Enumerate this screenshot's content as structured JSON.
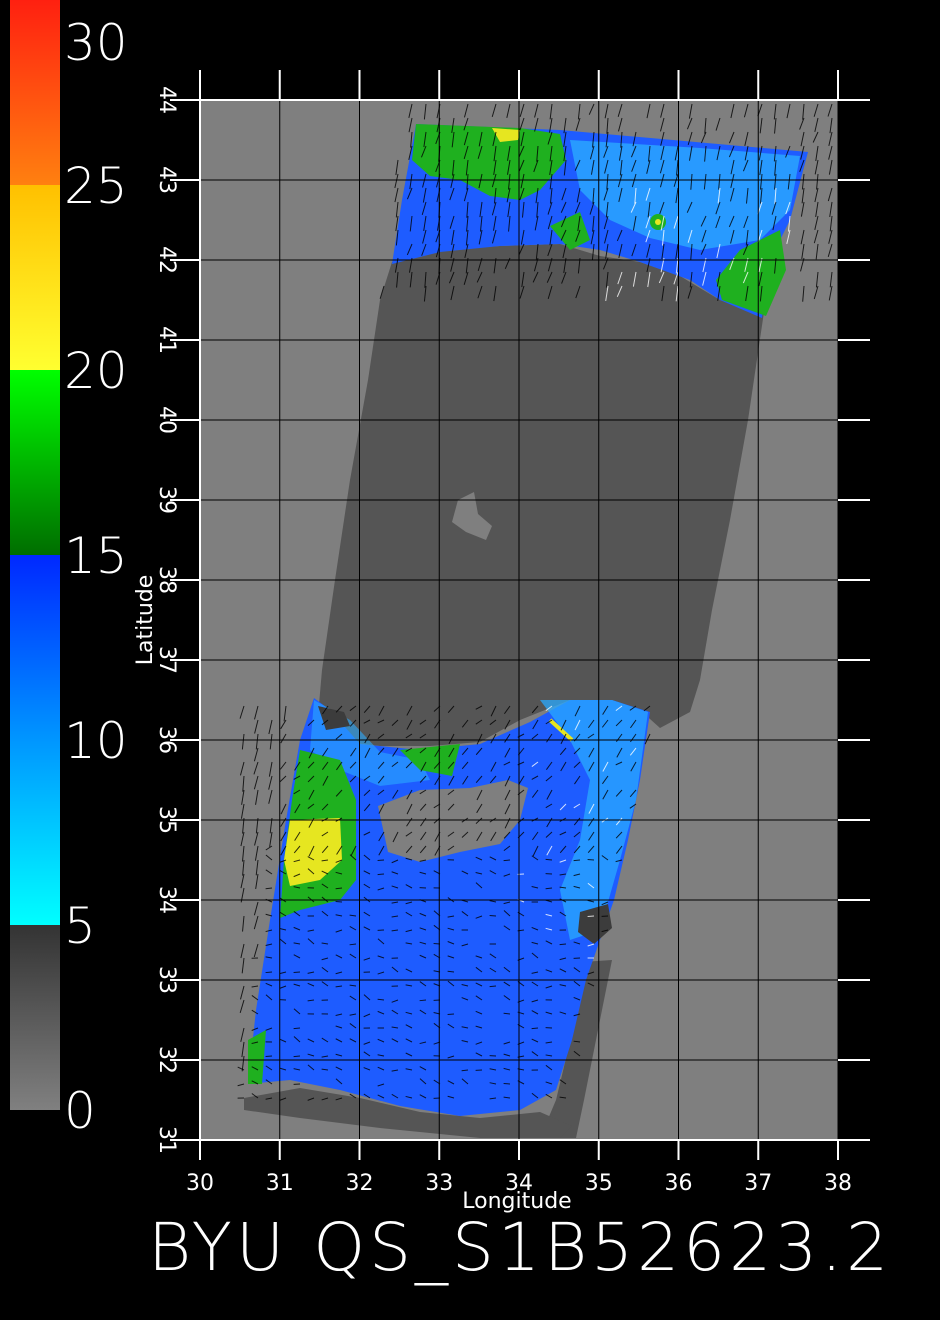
{
  "chart_data": {
    "type": "heatmap",
    "footer_text": "BYU  QS_S1B52623.2",
    "xlabel": "Longitude",
    "ylabel": "Latitude",
    "xlim": [
      30,
      38
    ],
    "ylim": [
      31,
      44
    ],
    "x_ticks": [
      "30",
      "31",
      "32",
      "33",
      "34",
      "35",
      "36",
      "37",
      "38"
    ],
    "y_ticks": [
      "31",
      "32",
      "33",
      "34",
      "35",
      "36",
      "37",
      "38",
      "39",
      "40",
      "41",
      "42",
      "43",
      "44"
    ],
    "colorbar": {
      "ticks": [
        "0",
        "5",
        "10",
        "15",
        "20",
        "25",
        "30"
      ],
      "range": [
        0,
        30
      ],
      "segments": [
        {
          "from": 0,
          "to": 5,
          "start": "#808080",
          "end": "#333333"
        },
        {
          "from": 5,
          "to": 10,
          "start": "#00ffff",
          "end": "#0096ff"
        },
        {
          "from": 10,
          "to": 15,
          "start": "#0096ff",
          "end": "#0028ff"
        },
        {
          "from": 15,
          "to": 20,
          "start": "#006e00",
          "end": "#00ff00"
        },
        {
          "from": 20,
          "to": 25,
          "start": "#ffff30",
          "end": "#ffc000"
        },
        {
          "from": 25,
          "to": 30,
          "start": "#ff8010",
          "end": "#ff2010"
        }
      ]
    },
    "colors": {
      "land": "#7f7f7f",
      "no_data_sea": "#555555",
      "low_wind": "#3c3c3c",
      "blue_wind": "#1e5cff",
      "cyan_wind": "#2aaaff",
      "green_wind": "#1fb01f",
      "yellow_wind": "#e6e620",
      "grid": "#000000",
      "frame": "#ffffff"
    }
  }
}
